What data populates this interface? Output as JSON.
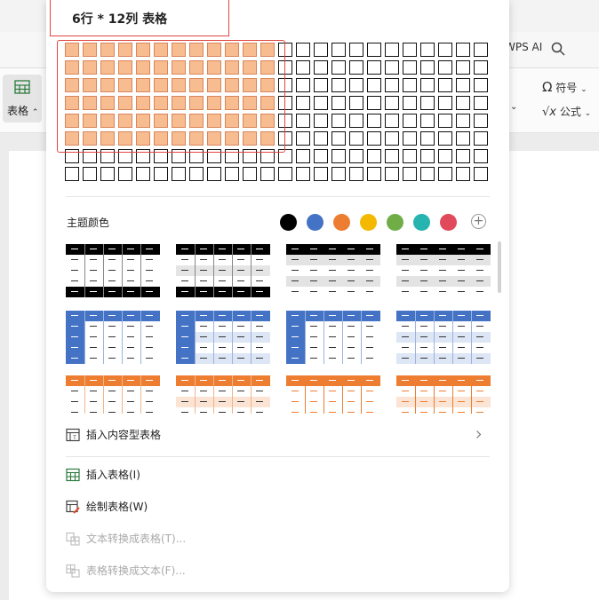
{
  "app": {
    "ribbon_right_label": "WPS AI",
    "symbol_label": "符号",
    "formula_label": "公式",
    "table_tool_label": "表格"
  },
  "picker": {
    "size_label": "6行 * 12列 表格",
    "rows_total": 8,
    "cols_total": 24,
    "selected_rows": 6,
    "selected_cols": 12
  },
  "theme": {
    "label": "主题颜色",
    "colors": [
      "#000000",
      "#4472c4",
      "#ed7d31",
      "#f4b800",
      "#70ad47",
      "#27b4b0",
      "#e14a5b"
    ],
    "add_symbol": "+"
  },
  "styles": {
    "palette": [
      "#000000",
      "#4472c4",
      "#ed7d31"
    ]
  },
  "menu": {
    "insert_content_table": "插入内容型表格",
    "insert_table": "插入表格(I)",
    "draw_table": "绘制表格(W)",
    "text_to_table": "文本转换成表格(T)...",
    "table_to_text": "表格转换成文本(F)..."
  }
}
